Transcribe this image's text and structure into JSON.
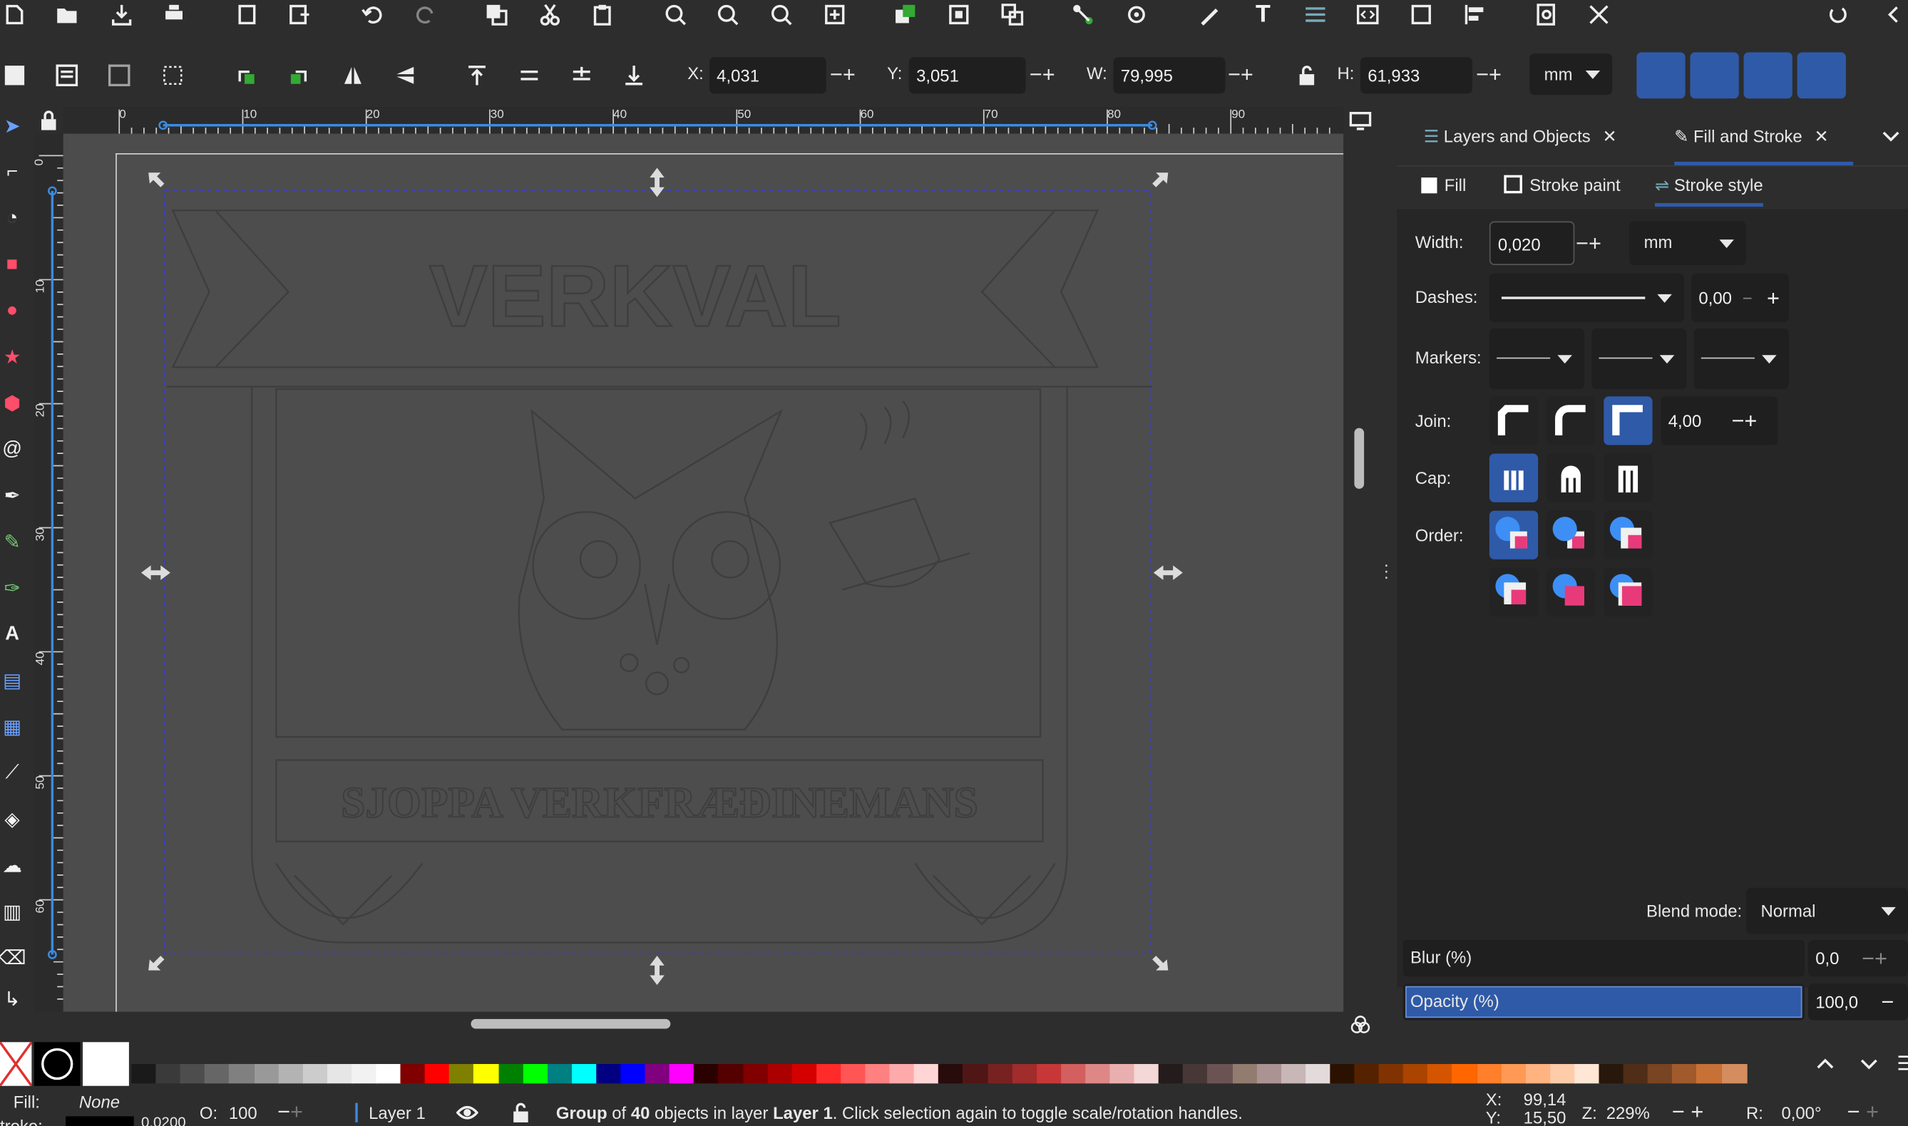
{
  "toolbar": {
    "x_label": "X:",
    "x_value": "4,031",
    "y_label": "Y:",
    "y_value": "3,051",
    "w_label": "W:",
    "w_value": "79,995",
    "h_label": "H:",
    "h_value": "61,933",
    "unit": "mm"
  },
  "ruler": {
    "h_ticks": [
      "0",
      "10",
      "20",
      "30",
      "40",
      "50",
      "60",
      "70",
      "80",
      "90"
    ],
    "v_ticks": [
      "0",
      "10",
      "20",
      "30",
      "40",
      "50",
      "60"
    ]
  },
  "artwork": {
    "title_text": "VERKVAL",
    "subtitle_text": "SJOPPA VERKFRÆÐINEMANS"
  },
  "panel": {
    "tab_layers": "Layers and Objects",
    "tab_fill_stroke": "Fill and Stroke",
    "subtab_fill": "Fill",
    "subtab_stroke_paint": "Stroke paint",
    "subtab_stroke_style": "Stroke style",
    "width_label": "Width:",
    "width_value": "0,020",
    "width_unit": "mm",
    "dashes_label": "Dashes:",
    "dashes_value": "0,00",
    "markers_label": "Markers:",
    "join_label": "Join:",
    "join_value": "4,00",
    "cap_label": "Cap:",
    "order_label": "Order:",
    "blend_label": "Blend mode:",
    "blend_value": "Normal",
    "blur_label": "Blur (%)",
    "blur_value": "0,0",
    "opacity_label": "Opacity (%)",
    "opacity_value": "100,0"
  },
  "status": {
    "fill_label": "Fill:",
    "fill_value": "None",
    "stroke_label": "troke:",
    "stroke_value": "0,0200",
    "opacity_label": "O:",
    "opacity_value": "100",
    "layer_name": "Layer 1",
    "msg_group": "Group",
    "msg_of": "of",
    "msg_count": "40",
    "msg_mid": "objects in layer",
    "msg_layer": "Layer 1",
    "msg_end": ". Click selection again to toggle scale/rotation handles.",
    "cx_label": "X:",
    "cx_value": "99,14",
    "cy_label": "Y:",
    "cy_value": "15,50",
    "zoom_label": "Z:",
    "zoom_value": "229%",
    "rot_label": "R:",
    "rot_value": "0,00°"
  },
  "colors": {
    "accent": "#2f5aa8",
    "selection": "#3b3bd0"
  },
  "palette": [
    "#1a1a1a",
    "#3a3a3a",
    "#4d4d4d",
    "#666666",
    "#808080",
    "#999999",
    "#b3b3b3",
    "#cccccc",
    "#e6e6e6",
    "#f2f2f2",
    "#ffffff",
    "#800000",
    "#ff0000",
    "#808000",
    "#ffff00",
    "#008000",
    "#00ff00",
    "#008080",
    "#00ffff",
    "#000080",
    "#0000ff",
    "#800080",
    "#ff00ff",
    "#2b0000",
    "#550000",
    "#800000",
    "#aa0000",
    "#d40000",
    "#ff2a2a",
    "#ff5555",
    "#ff8080",
    "#ffaaaa",
    "#ffd5d5",
    "#280b0b",
    "#501616",
    "#782121",
    "#a02c2c",
    "#c83737",
    "#d35f5f",
    "#de8787",
    "#e9afaf",
    "#f4d7d7",
    "#241c1c",
    "#483737",
    "#6c5353",
    "#917c6f",
    "#ac9393",
    "#c8b7b7",
    "#e3dbdb",
    "#2b1100",
    "#552200",
    "#803300",
    "#aa4400",
    "#d45500",
    "#ff6600",
    "#ff7f2a",
    "#ff9955",
    "#ffb380",
    "#ffccaa",
    "#ffe6d5",
    "#28170b",
    "#502d16",
    "#784421",
    "#a05a2c",
    "#c87137",
    "#d38d5f"
  ]
}
